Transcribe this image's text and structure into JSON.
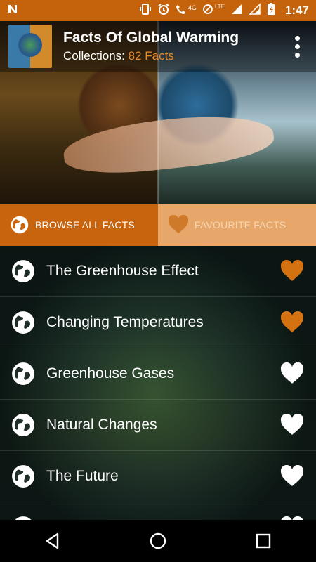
{
  "status_bar": {
    "time": "1:47",
    "network": "4G",
    "lte": "LTE",
    "icons": [
      "notification-n-icon",
      "vibrate-icon",
      "alarm-icon",
      "phone-icon",
      "signal-icon",
      "wifi-off-icon",
      "signal-icon",
      "battery-charging-icon"
    ]
  },
  "header": {
    "title": "Facts Of Global Warming",
    "collections_label": "Collections:",
    "collections_count": "82 Facts"
  },
  "tabs": [
    {
      "label": "BROWSE ALL FACTS",
      "active": true
    },
    {
      "label": "FAVOURITE FACTS",
      "active": false
    }
  ],
  "facts": [
    {
      "label": "The Greenhouse Effect",
      "favourite": true
    },
    {
      "label": "Changing Temperatures",
      "favourite": true
    },
    {
      "label": "Greenhouse Gases",
      "favourite": false
    },
    {
      "label": "Natural Changes",
      "favourite": false
    },
    {
      "label": "The Future",
      "favourite": false
    },
    {
      "label": "",
      "favourite": false
    }
  ],
  "colors": {
    "accent": "#c9640e",
    "accent_light": "#e7a66a",
    "favourite_heart": "#d47212",
    "default_heart": "#ffffff"
  }
}
